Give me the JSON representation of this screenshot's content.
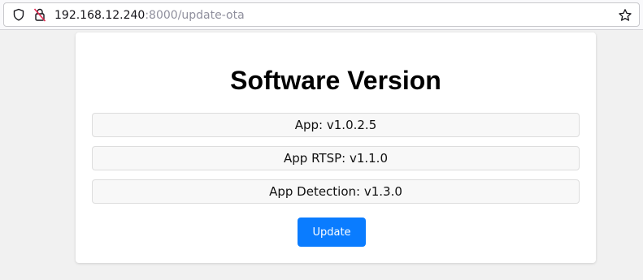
{
  "browser": {
    "url_host": "192.168.12.240",
    "url_rest": ":8000/update-ota",
    "icons": {
      "shield": "shield-icon",
      "lock": "lock-crossed-icon",
      "bookmark": "star-icon"
    }
  },
  "page": {
    "title": "Software Version",
    "versions": [
      {
        "label": "App: v1.0.2.5"
      },
      {
        "label": "App RTSP: v1.1.0"
      },
      {
        "label": "App Detection: v1.3.0"
      }
    ],
    "update_button": "Update",
    "colors": {
      "accent": "#0a7cff",
      "background": "#f1f1f1"
    }
  }
}
